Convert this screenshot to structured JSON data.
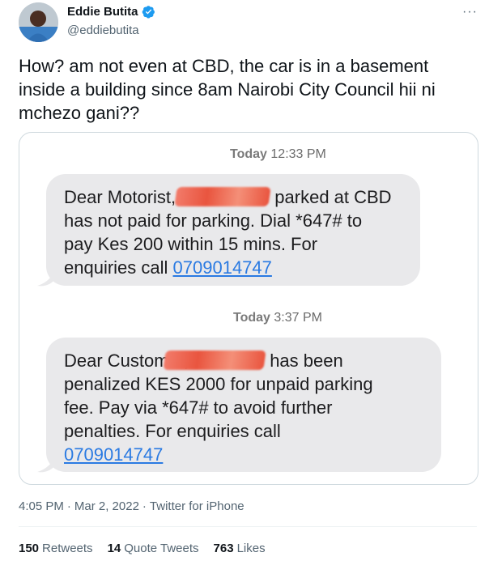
{
  "author": {
    "name": "Eddie Butita",
    "handle": "@eddiebutita",
    "verified": true
  },
  "tweet": {
    "text": "How? am not even at CBD, the car is in a basement inside a building since 8am Nairobi City Council hii ni mchezo gani??"
  },
  "messages": [
    {
      "time_day": "Today",
      "time_clock": "12:33 PM",
      "line1_a": "Dear Motorist,",
      "line1_b": "parked at CBD",
      "line2": "has not paid for parking. Dial *647# to",
      "line3": "pay Kes 200 within 15 mins. For",
      "line4": "enquiries call",
      "phone": "0709014747"
    },
    {
      "time_day": "Today",
      "time_clock": "3:37 PM",
      "line1_a": "Dear Customer,",
      "line1_b": "has been",
      "line2": "penalized KES 2000 for unpaid parking",
      "line3": "fee. Pay via *647# to avoid further",
      "line4": "penalties. For enquiries call",
      "phone": "0709014747"
    }
  ],
  "meta": {
    "time": "4:05 PM",
    "date": "Mar 2, 2022",
    "source": "Twitter for iPhone"
  },
  "stats": {
    "retweets_count": "150",
    "retweets_label": "Retweets",
    "quotes_count": "14",
    "quotes_label": "Quote Tweets",
    "likes_count": "763",
    "likes_label": "Likes"
  },
  "icons": {
    "verified": "verified-badge-icon",
    "more": "more-icon"
  },
  "colors": {
    "link": "#2a7ae2",
    "verified": "#1d9bf0",
    "bubble": "#e9e9eb"
  }
}
